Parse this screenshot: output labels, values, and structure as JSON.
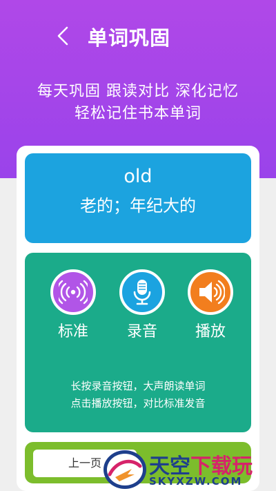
{
  "header": {
    "title": "单词巩固",
    "slogan_line1": "每天巩固 跟读对比 深化记忆",
    "slogan_line2": "轻松记住书本单词"
  },
  "word_card": {
    "word": "old",
    "meaning": "老的；年纪大的"
  },
  "controls": [
    {
      "label": "标准",
      "icon": "sound-wave-icon",
      "color": "#b155e7"
    },
    {
      "label": "录音",
      "icon": "microphone-icon",
      "color": "#1ba3e0"
    },
    {
      "label": "播放",
      "icon": "speaker-icon",
      "color": "#f27e1e"
    }
  ],
  "tips": {
    "line1": "长按录音按钮，大声朗读单词",
    "line2": "点击播放按钮，对比标准发音"
  },
  "navigation": {
    "prev_label": "上一页"
  },
  "watermark": {
    "brand_part1": "天空",
    "brand_part2": "下载玩",
    "url": "SKYXZW.COM"
  },
  "colors": {
    "header_purple": "#a946e9",
    "word_blue": "#1ca3df",
    "audio_green": "#1bab8a",
    "nav_green": "#7cbd2c"
  }
}
